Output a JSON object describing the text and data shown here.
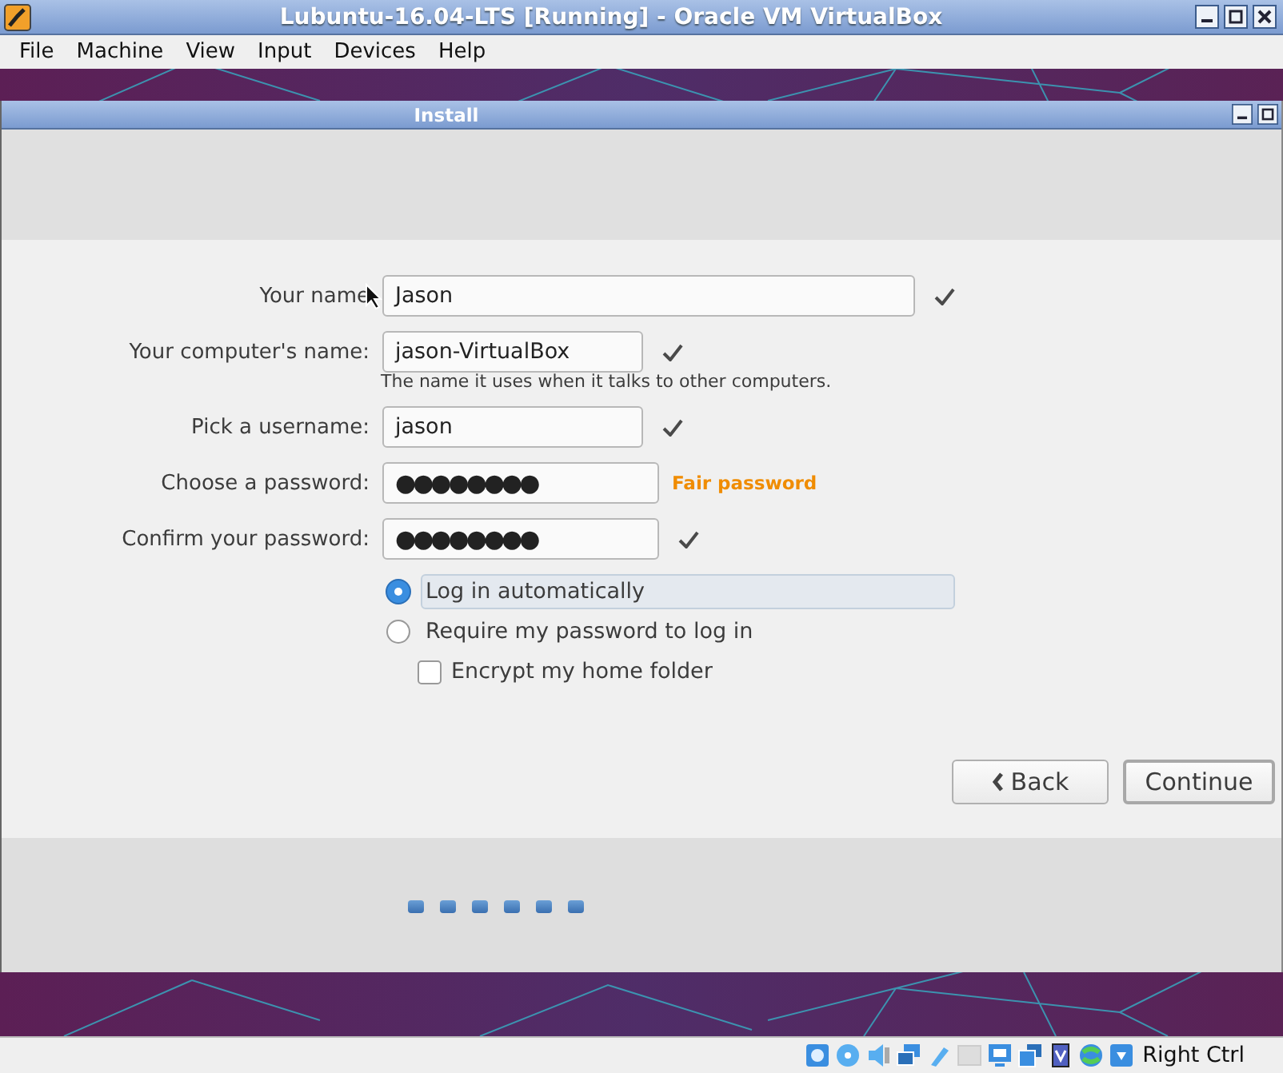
{
  "window": {
    "title": "Lubuntu-16.04-LTS [Running] - Oracle VM VirtualBox"
  },
  "menu": [
    "File",
    "Machine",
    "View",
    "Input",
    "Devices",
    "Help"
  ],
  "installer": {
    "title": "Install",
    "fields": [
      {
        "label": "Your name",
        "value": "Jason",
        "kind": "text",
        "valid": true
      },
      {
        "label": "Your computer's name:",
        "value": "jason-VirtualBox",
        "kind": "text",
        "valid": true,
        "hint": "The name it uses when it talks to other computers."
      },
      {
        "label": "Pick a username:",
        "value": "jason",
        "kind": "text",
        "valid": true
      },
      {
        "label": "Choose a password:",
        "value": "●●●●●●●●",
        "kind": "password",
        "valid": false,
        "strength": "Fair password"
      },
      {
        "label": "Confirm your password:",
        "value": "●●●●●●●●",
        "kind": "password",
        "valid": true
      }
    ],
    "login_options": [
      {
        "label": "Log in automatically",
        "selected": true
      },
      {
        "label": "Require my password to log in",
        "selected": false
      }
    ],
    "encrypt": {
      "label": "Encrypt my home folder",
      "checked": false
    },
    "buttons": [
      {
        "label": "Back",
        "kind": "back"
      },
      {
        "label": "Continue",
        "kind": "default"
      }
    ]
  },
  "status_bar": {
    "host_key": "Right Ctrl"
  }
}
